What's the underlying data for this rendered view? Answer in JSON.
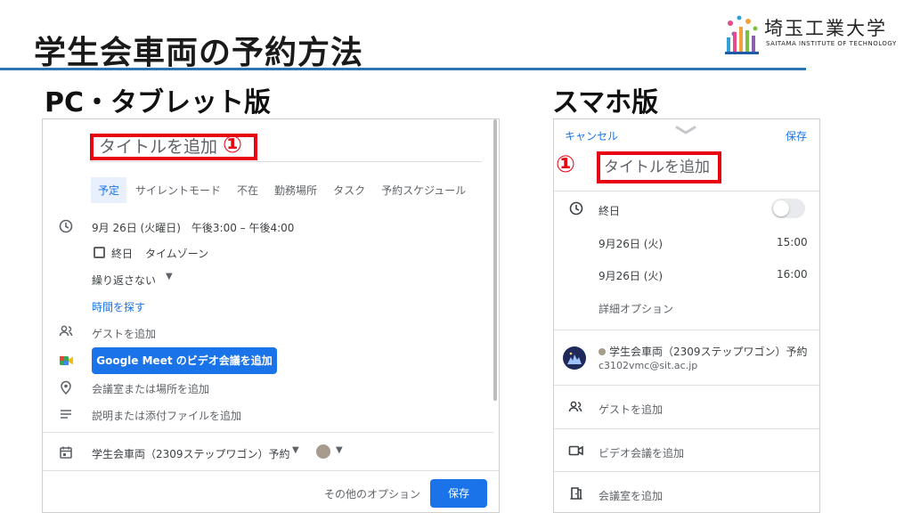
{
  "slide": {
    "title": "学生会車両の予約方法",
    "logo_name": "埼玉工業大学",
    "logo_sub": "SAITAMA INSTITUTE OF TECHNOLOGY",
    "accent_color": "#2e75b6",
    "highlight_color": "#e60012"
  },
  "pc": {
    "heading": "PC・タブレット版",
    "title_placeholder": "タイトルを追加",
    "marker": "①",
    "tabs": [
      {
        "label": "予定",
        "active": true
      },
      {
        "label": "サイレントモード",
        "active": false
      },
      {
        "label": "不在",
        "active": false
      },
      {
        "label": "勤務場所",
        "active": false
      },
      {
        "label": "タスク",
        "active": false
      },
      {
        "label": "予約スケジュール",
        "active": false
      }
    ],
    "datetime": "9月 26日 (火曜日)　午後3:00 – 午後4:00",
    "allday_label": "終日",
    "timezone_label": "タイムゾーン",
    "repeat_label": "繰り返さない",
    "find_time_label": "時間を探す",
    "add_guest_label": "ゲストを追加",
    "meet_button": "Google Meet のビデオ会議を追加",
    "location_label": "会議室または場所を追加",
    "description_label": "説明または添付ファイルを追加",
    "calendar_label": "学生会車両（2309ステップワゴン）予約",
    "more_options": "その他のオプション",
    "save": "保存",
    "primary_color": "#1a73e8"
  },
  "sp": {
    "heading": "スマホ版",
    "cancel": "キャンセル",
    "save": "保存",
    "title_placeholder": "タイトルを追加",
    "marker": "①",
    "allday_label": "終日",
    "allday_on": false,
    "start_date": "9月26日 (火)",
    "start_time": "15:00",
    "end_date": "9月26日 (火)",
    "end_time": "16:00",
    "detail_options": "詳細オプション",
    "calendar_name": "学生会車両（2309ステップワゴン）予約",
    "calendar_email": "c3102vmc@sit.ac.jp",
    "add_guest": "ゲストを追加",
    "add_video": "ビデオ会議を追加",
    "add_room": "会議室を追加"
  }
}
